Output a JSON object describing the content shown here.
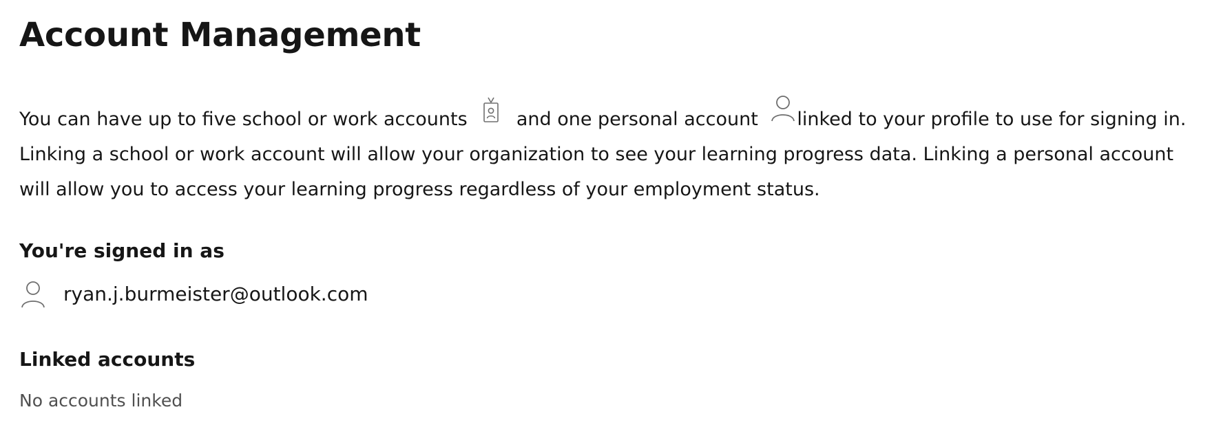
{
  "page": {
    "title": "Account Management"
  },
  "intro": {
    "part1": "You can have up to five school or work accounts",
    "part2": "and one personal account",
    "part3": "linked to your profile to use for signing in. Linking a school or work account will allow your organization to see your learning progress data. Linking a personal account will allow you to access your learning progress regardless of your employment status.",
    "school_work_icon": "id-badge-icon",
    "personal_icon": "person-icon"
  },
  "signed_in": {
    "heading": "You're signed in as",
    "email": "ryan.j.burmeister@outlook.com",
    "icon": "person-icon"
  },
  "linked_accounts": {
    "heading": "Linked accounts",
    "empty_text": "No accounts linked"
  },
  "colors": {
    "text_primary": "#161616",
    "text_secondary": "#505050",
    "icon_stroke": "#6e6e6e",
    "background": "#ffffff"
  }
}
